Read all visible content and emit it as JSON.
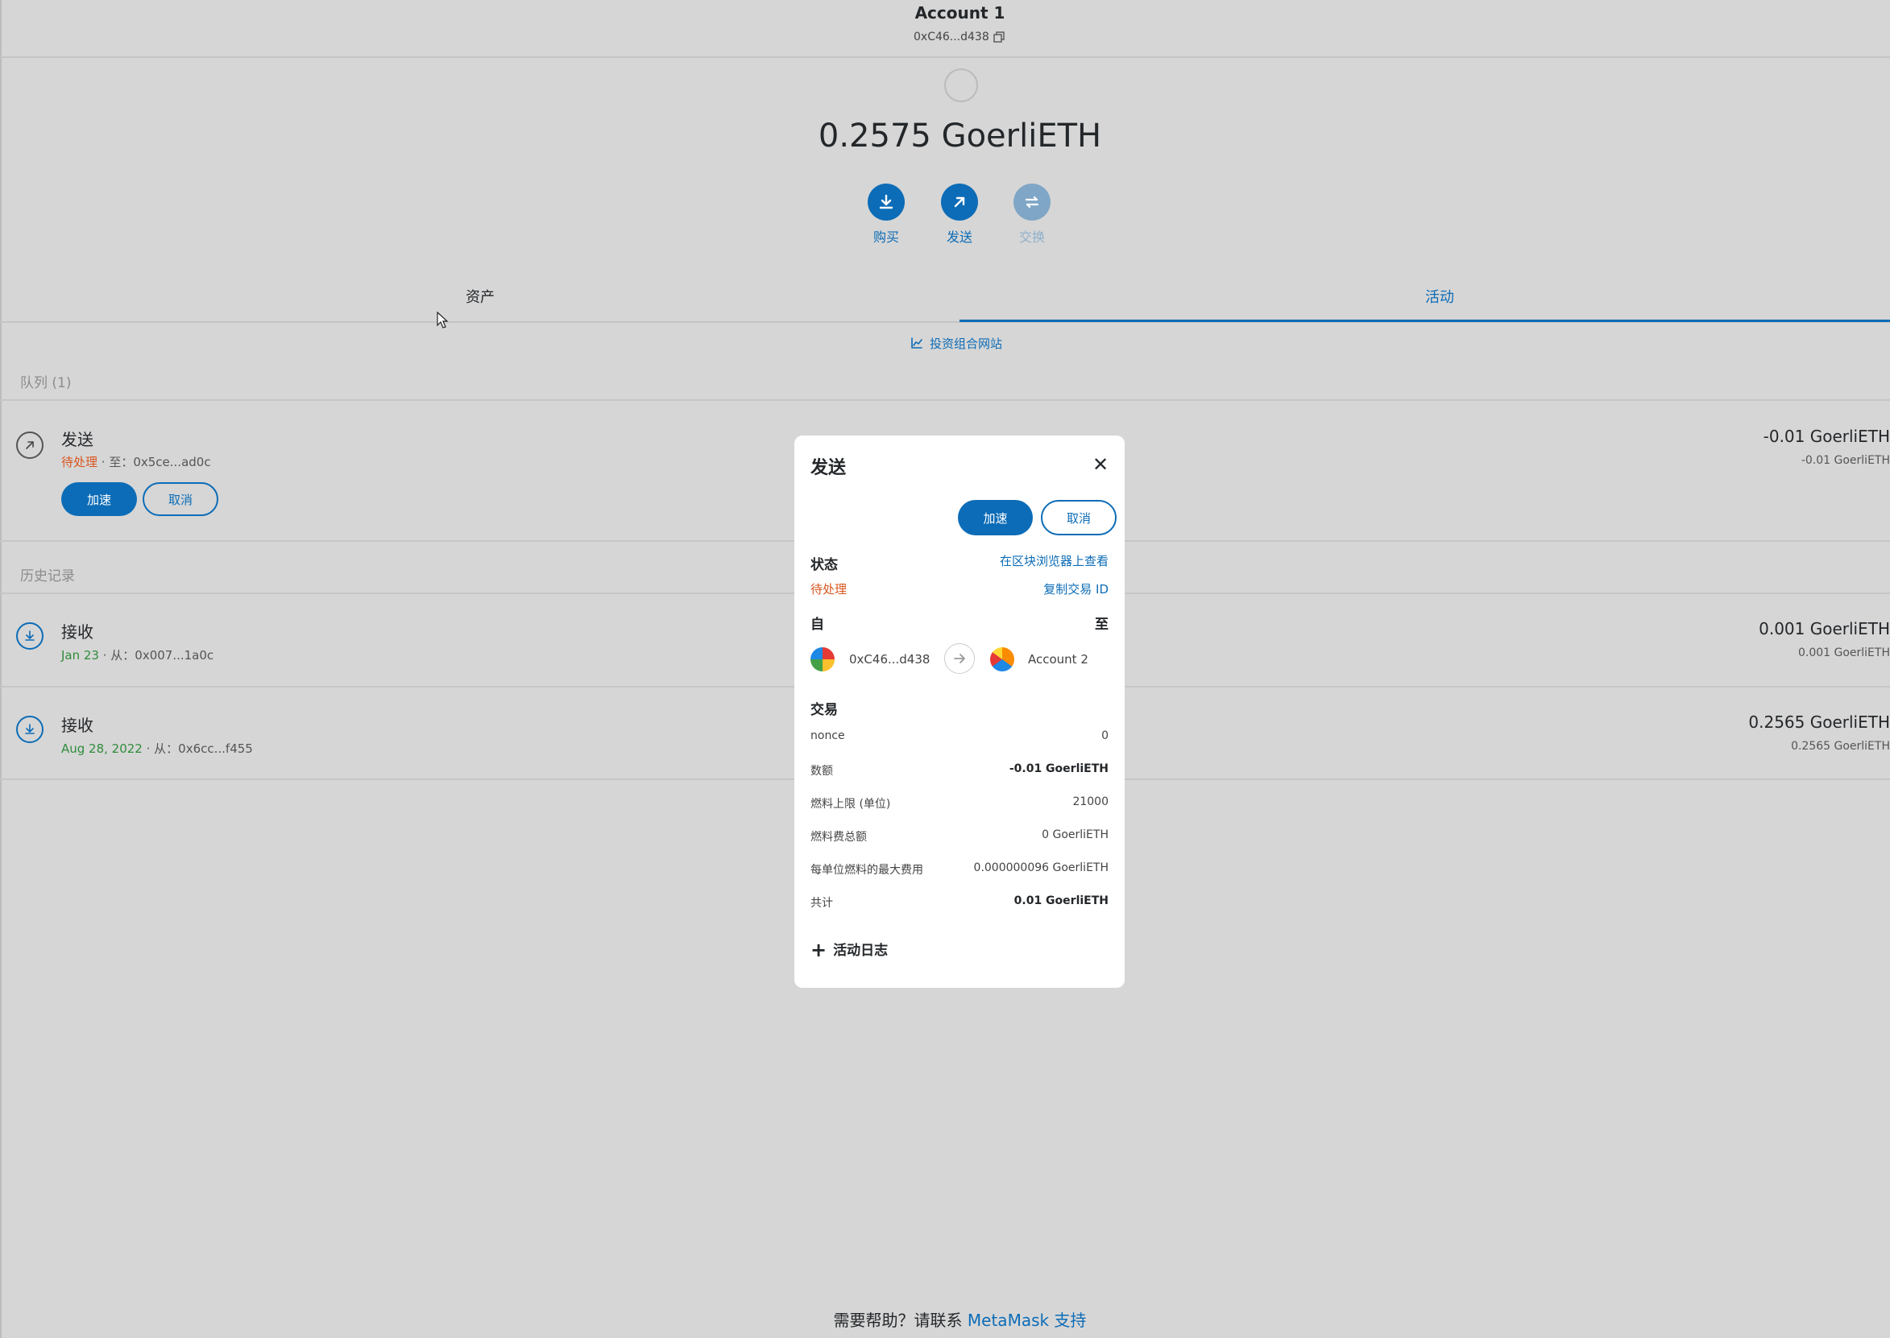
{
  "header": {
    "account_name": "Account 1",
    "account_address": "0xC46...d438",
    "balance": "0.2575 GoerliETH"
  },
  "actions": {
    "buy": "购买",
    "send": "发送",
    "swap": "交换"
  },
  "tabs": {
    "assets": "资产",
    "activity": "活动"
  },
  "portfolio_link": "投资组合网站",
  "queue": {
    "title": "队列 (1)",
    "items": [
      {
        "title": "发送",
        "status": "待处理",
        "detail": " · 至：0x5ce...ad0c",
        "amount": "-0.01 GoerliETH",
        "amount_secondary": "-0.01 GoerliETH",
        "speed_up_label": "加速",
        "cancel_label": "取消"
      }
    ]
  },
  "history": {
    "title": "历史记录",
    "items": [
      {
        "title": "接收",
        "date": "Jan 23",
        "detail": " · 从：0x007...1a0c",
        "amount": "0.001 GoerliETH",
        "amount_secondary": "0.001 GoerliETH"
      },
      {
        "title": "接收",
        "date": "Aug 28, 2022",
        "detail": " · 从：0x6cc...f455",
        "amount": "0.2565 GoerliETH",
        "amount_secondary": "0.2565 GoerliETH"
      }
    ]
  },
  "modal": {
    "title": "发送",
    "close": "✕",
    "speed_up_label": "加速",
    "cancel_label": "取消",
    "status_label": "状态",
    "view_explorer": "在区块浏览器上查看",
    "status_value": "待处理",
    "copy_tx_id": "复制交易 ID",
    "from_label": "自",
    "to_label": "至",
    "from_address": "0xC46...d438",
    "to_account": "Account 2",
    "transaction_label": "交易",
    "rows": [
      {
        "label": "nonce",
        "value": "0"
      },
      {
        "label": "数额",
        "value": "-0.01 GoerliETH"
      },
      {
        "label": "燃料上限 (单位)",
        "value": "21000"
      },
      {
        "label": "燃料费总额",
        "value": "0 GoerliETH"
      },
      {
        "label": "每单位燃料的最大费用",
        "value": "0.000000096 GoerliETH"
      },
      {
        "label": "共计",
        "value": "0.01 GoerliETH"
      }
    ],
    "activity_log_label": "活动日志"
  },
  "footer": {
    "prefix": "需要帮助？请联系 ",
    "link": "MetaMask 支持"
  },
  "colors": {
    "accent": "#0c6cb7",
    "pending": "#d9561f",
    "success_date": "#2f8c3c"
  }
}
